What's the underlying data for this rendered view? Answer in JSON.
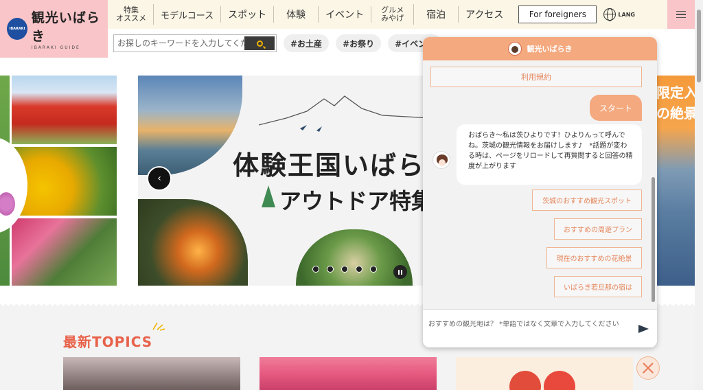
{
  "header": {
    "logo_badge": "IBARAKI",
    "logo_main": "観光いばらき",
    "logo_sub": "IBARAKI GUIDE",
    "nav": [
      {
        "label": "特集\nオススメ",
        "two_line": true
      },
      {
        "label": "モデルコース"
      },
      {
        "label": "スポット"
      },
      {
        "label": "体験"
      },
      {
        "label": "イベント"
      },
      {
        "label": "グルメ\nみやげ",
        "two_line": true
      },
      {
        "label": "宿泊"
      },
      {
        "label": "アクセス"
      }
    ],
    "foreigners_button": "For foreigners",
    "lang_label": "LANG"
  },
  "search": {
    "placeholder": "お探しのキーワードを入力してください",
    "tags": [
      "#お土産",
      "#お祭り",
      "#イベント"
    ]
  },
  "hero": {
    "headline": "体験王国いばらき",
    "subline": "アウトドア特集",
    "side_text": "限定入\nの絶景"
  },
  "topics": {
    "title": "最新TOPICS"
  },
  "chat": {
    "title": "観光いばらき",
    "terms_button": "利用規約",
    "start_button": "スタート",
    "bot_message": "おばらき〜私は茨ひよりです！ひよりんって呼んでね。茨城の観光情報をお届けします♪　*話題が変わる時は、ページをリロードして再質問すると回答の精度が上がります",
    "suggestions": [
      "茨城のおすすめ観光スポット",
      "おすすめの周遊プラン",
      "現在のおすすめの花絶景",
      "いばらき若旦那の宿は"
    ],
    "input_placeholder": "おすすめの観光地は？ *単語ではなく文章で入力してください"
  },
  "colors": {
    "accent_pink": "#f9c5c8",
    "nav_bg": "#fbf6e6",
    "chat_orange": "#f4a97f",
    "topics_red": "#e8614a"
  }
}
